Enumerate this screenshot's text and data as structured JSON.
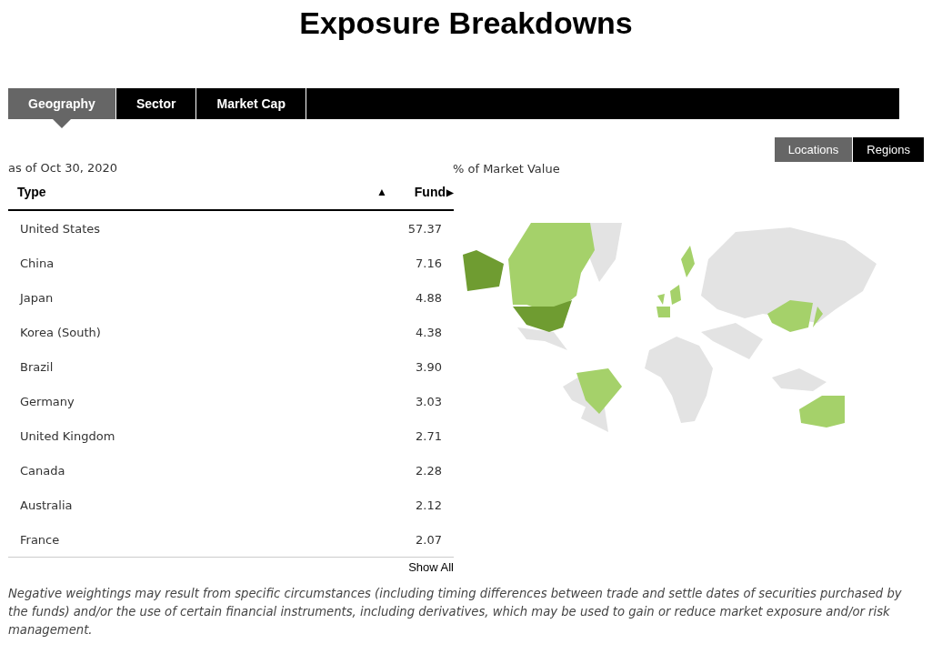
{
  "title": "Exposure Breakdowns",
  "tabs": [
    {
      "label": "Geography",
      "selected": true
    },
    {
      "label": "Sector",
      "selected": false
    },
    {
      "label": "Market Cap",
      "selected": false
    }
  ],
  "as_of": "as of Oct 30, 2020",
  "view_toggle": [
    {
      "label": "Locations",
      "selected": true
    },
    {
      "label": "Regions",
      "selected": false
    }
  ],
  "map_caption": "% of Market Value",
  "table": {
    "columns": [
      "Type",
      "Fund"
    ],
    "sort_icon": "▲",
    "fund_arrow": "▶",
    "rows": [
      {
        "type": "United States",
        "fund": "57.37"
      },
      {
        "type": "China",
        "fund": "7.16"
      },
      {
        "type": "Japan",
        "fund": "4.88"
      },
      {
        "type": "Korea (South)",
        "fund": "4.38"
      },
      {
        "type": "Brazil",
        "fund": "3.90"
      },
      {
        "type": "Germany",
        "fund": "3.03"
      },
      {
        "type": "United Kingdom",
        "fund": "2.71"
      },
      {
        "type": "Canada",
        "fund": "2.28"
      },
      {
        "type": "Australia",
        "fund": "2.12"
      },
      {
        "type": "France",
        "fund": "2.07"
      }
    ]
  },
  "show_all": "Show All",
  "footnote": "Negative weightings may result from specific circumstances (including timing differences between trade and settle dates of securities purchased by the funds) and/or the use of certain financial instruments, including derivatives, which may be used to gain or reduce market exposure and/or risk management."
}
